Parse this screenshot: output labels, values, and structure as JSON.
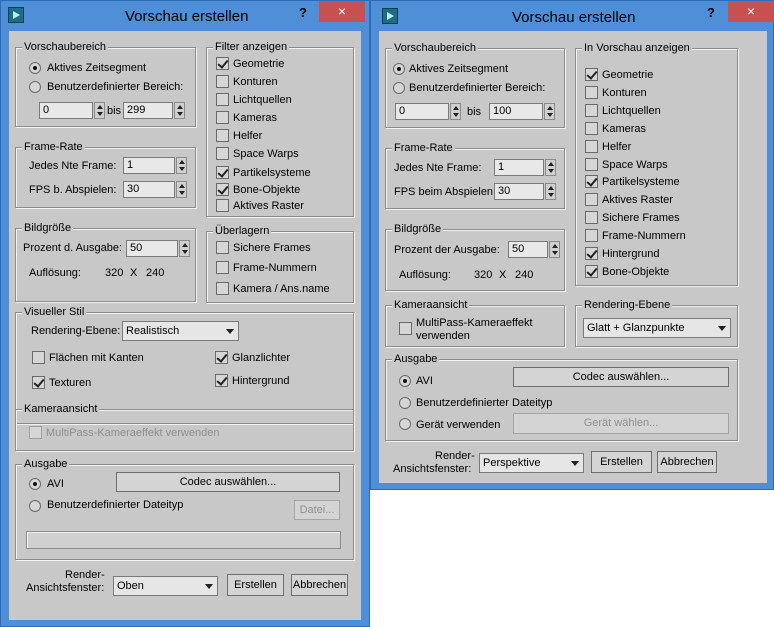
{
  "left": {
    "title": "Vorschau erstellen",
    "help": "?",
    "close": "×",
    "preview_range": {
      "title": "Vorschaubereich",
      "active_segment": "Aktives Zeitsegment",
      "custom_range": "Benutzerdefinierter Bereich:",
      "from": "0",
      "to_label": "bis",
      "to": "299"
    },
    "filter": {
      "title": "Filter anzeigen",
      "items": [
        {
          "label": "Geometrie",
          "checked": true
        },
        {
          "label": "Konturen",
          "checked": false
        },
        {
          "label": "Lichtquellen",
          "checked": false
        },
        {
          "label": "Kameras",
          "checked": false
        },
        {
          "label": "Helfer",
          "checked": false
        },
        {
          "label": "Space Warps",
          "checked": false
        },
        {
          "label": "Partikelsysteme",
          "checked": true
        },
        {
          "label": "Bone-Objekte",
          "checked": true
        },
        {
          "label": "Aktives Raster",
          "checked": false
        }
      ]
    },
    "frame_rate": {
      "title": "Frame-Rate",
      "nth_label": "Jedes Nte Frame:",
      "nth_value": "1",
      "fps_label": "FPS b. Abspielen:",
      "fps_value": "30"
    },
    "overlay": {
      "title": "Überlagern",
      "items": [
        {
          "label": "Sichere Frames",
          "checked": false
        },
        {
          "label": "Frame-Nummern",
          "checked": false
        },
        {
          "label": "Kamera / Ans.name",
          "checked": false
        }
      ]
    },
    "image_size": {
      "title": "Bildgröße",
      "percent_label": "Prozent d. Ausgabe:",
      "percent_value": "50",
      "res_label": "Auflösung:",
      "res_w": "320",
      "res_x": "X",
      "res_h": "240"
    },
    "visual_style": {
      "title": "Visueller Stil",
      "render_level_label": "Rendering-Ebene:",
      "render_level_value": "Realistisch",
      "edged_faces": {
        "label": "Flächen mit Kanten",
        "checked": false
      },
      "highlights": {
        "label": "Glanzlichter",
        "checked": true
      },
      "textures": {
        "label": "Texturen",
        "checked": true
      },
      "background": {
        "label": "Hintergrund",
        "checked": true
      }
    },
    "camera_view": {
      "title": "Kameraansicht",
      "multipass": {
        "label": "MultiPass-Kameraeffekt verwenden",
        "checked": false
      }
    },
    "output": {
      "title": "Ausgabe",
      "avi": "AVI",
      "codec_button": "Codec auswählen...",
      "custom_type": "Benutzerdefinierter Dateityp",
      "file_button": "Datei..."
    },
    "render_viewport_label_1": "Render-",
    "render_viewport_label_2": "Ansichtsfenster:",
    "viewport_value": "Oben",
    "create": "Erstellen",
    "cancel": "Abbrechen"
  },
  "right": {
    "title": "Vorschau erstellen",
    "help": "?",
    "close": "×",
    "preview_range": {
      "title": "Vorschaubereich",
      "active_segment": "Aktives Zeitsegment",
      "custom_range": "Benutzerdefinierter Bereich:",
      "from": "0",
      "to_label": "bis",
      "to": "100"
    },
    "show_in_preview": {
      "title": "In Vorschau anzeigen",
      "items": [
        {
          "label": "Geometrie",
          "checked": true
        },
        {
          "label": "Konturen",
          "checked": false
        },
        {
          "label": "Lichtquellen",
          "checked": false
        },
        {
          "label": "Kameras",
          "checked": false
        },
        {
          "label": "Helfer",
          "checked": false
        },
        {
          "label": "Space Warps",
          "checked": false
        },
        {
          "label": "Partikelsysteme",
          "checked": true
        },
        {
          "label": "Aktives Raster",
          "checked": false
        },
        {
          "label": "Sichere Frames",
          "checked": false
        },
        {
          "label": "Frame-Nummern",
          "checked": false
        },
        {
          "label": "Hintergrund",
          "checked": true
        },
        {
          "label": "Bone-Objekte",
          "checked": true
        }
      ]
    },
    "frame_rate": {
      "title": "Frame-Rate",
      "nth_label": "Jedes Nte Frame:",
      "nth_value": "1",
      "fps_label": "FPS beim Abspielen:",
      "fps_value": "30"
    },
    "image_size": {
      "title": "Bildgröße",
      "percent_label": "Prozent der Ausgabe:",
      "percent_value": "50",
      "res_label": "Auflösung:",
      "res_w": "320",
      "res_x": "X",
      "res_h": "240"
    },
    "camera_view": {
      "title": "Kameraansicht",
      "multipass_1": "MultiPass-Kameraeffekt",
      "multipass_2": "verwenden"
    },
    "render_level": {
      "title": "Rendering-Ebene",
      "value": "Glatt + Glanzpunkte"
    },
    "output": {
      "title": "Ausgabe",
      "avi": "AVI",
      "codec_button": "Codec auswählen...",
      "custom_type": "Benutzerdefinierter Dateityp",
      "device": "Gerät verwenden",
      "device_button": "Gerät wählen..."
    },
    "render_viewport_label_1": "Render-",
    "render_viewport_label_2": "Ansichtsfenster:",
    "viewport_value": "Perspektive",
    "create": "Erstellen",
    "cancel": "Abbrechen"
  }
}
